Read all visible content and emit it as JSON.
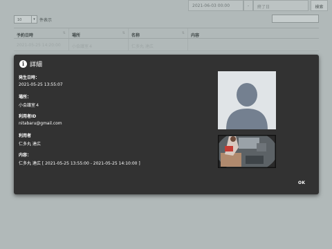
{
  "search": {
    "date_from": "2021-06-03 00:00",
    "separator": "-",
    "date_to_placeholder": "終了日",
    "button_label": "検索"
  },
  "entries": {
    "selected": "10",
    "label": "件表示"
  },
  "table": {
    "headers": [
      "予約日時",
      "場所",
      "名称",
      "内容"
    ],
    "row": [
      "2021-05-25 14:20:00",
      "小会議室４",
      "仁多丸 達広",
      ""
    ]
  },
  "modal": {
    "title": "詳細",
    "fields": [
      {
        "label": "発生日時：",
        "value": "2021-05-25 13:55:07"
      },
      {
        "label": "場所：",
        "value": "小会議室４"
      },
      {
        "label": "利用者ID",
        "value": "nitabaru@gmail.com"
      },
      {
        "label": "利用者",
        "value": "仁多丸 達広"
      },
      {
        "label": "内容：",
        "value": "仁多丸 達広 [ 2021-05-25 13:55:00 - 2021-05-25 14:10:00 ]"
      }
    ],
    "ok_label": "OK"
  },
  "colors": {
    "overlay_bg": "#b1b9b9",
    "modal_bg": "#323232",
    "text": "#ffffff"
  }
}
